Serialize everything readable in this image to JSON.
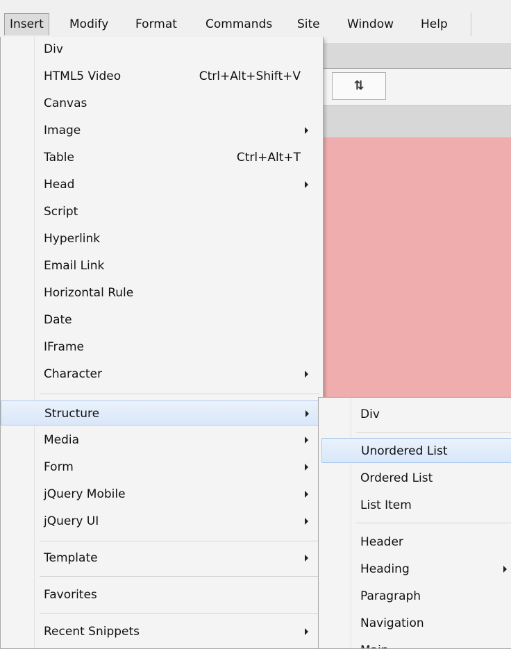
{
  "menubar": {
    "items": [
      "Insert",
      "Modify",
      "Format",
      "Commands",
      "Site",
      "Window",
      "Help"
    ],
    "active": "Insert"
  },
  "toolbar": {
    "sort_icon_glyph": "⇅"
  },
  "insert_menu": {
    "items": [
      {
        "label": "Div",
        "shortcut": "",
        "submenu": false
      },
      {
        "label": "HTML5 Video",
        "shortcut": "Ctrl+Alt+Shift+V",
        "submenu": false
      },
      {
        "label": "Canvas",
        "shortcut": "",
        "submenu": false
      },
      {
        "label": "Image",
        "shortcut": "",
        "submenu": true
      },
      {
        "label": "Table",
        "shortcut": "Ctrl+Alt+T",
        "submenu": false
      },
      {
        "label": "Head",
        "shortcut": "",
        "submenu": true
      },
      {
        "label": "Script",
        "shortcut": "",
        "submenu": false
      },
      {
        "label": "Hyperlink",
        "shortcut": "",
        "submenu": false
      },
      {
        "label": "Email Link",
        "shortcut": "",
        "submenu": false
      },
      {
        "label": "Horizontal Rule",
        "shortcut": "",
        "submenu": false
      },
      {
        "label": "Date",
        "shortcut": "",
        "submenu": false
      },
      {
        "label": "IFrame",
        "shortcut": "",
        "submenu": false
      },
      {
        "label": "Character",
        "shortcut": "",
        "submenu": true
      },
      {
        "label": "Structure",
        "shortcut": "",
        "submenu": true,
        "highlighted": true
      },
      {
        "label": "Media",
        "shortcut": "",
        "submenu": true
      },
      {
        "label": "Form",
        "shortcut": "",
        "submenu": true
      },
      {
        "label": "jQuery Mobile",
        "shortcut": "",
        "submenu": true
      },
      {
        "label": "jQuery UI",
        "shortcut": "",
        "submenu": true
      },
      {
        "label": "Template",
        "shortcut": "",
        "submenu": true
      },
      {
        "label": "Favorites",
        "shortcut": "",
        "submenu": false
      },
      {
        "label": "Recent Snippets",
        "shortcut": "",
        "submenu": true
      }
    ]
  },
  "structure_submenu": {
    "items": [
      {
        "label": "Div",
        "submenu": false
      },
      {
        "label": "Unordered List",
        "submenu": false,
        "highlighted": true
      },
      {
        "label": "Ordered List",
        "submenu": false
      },
      {
        "label": "List Item",
        "submenu": false
      },
      {
        "label": "Header",
        "submenu": false
      },
      {
        "label": "Heading",
        "submenu": true
      },
      {
        "label": "Paragraph",
        "submenu": false
      },
      {
        "label": "Navigation",
        "submenu": false
      },
      {
        "label": "Main",
        "submenu": false
      }
    ]
  },
  "colors": {
    "highlight": "#d9e7f9",
    "highlight_border": "#a8c8ef",
    "document_background": "#f0adad"
  }
}
